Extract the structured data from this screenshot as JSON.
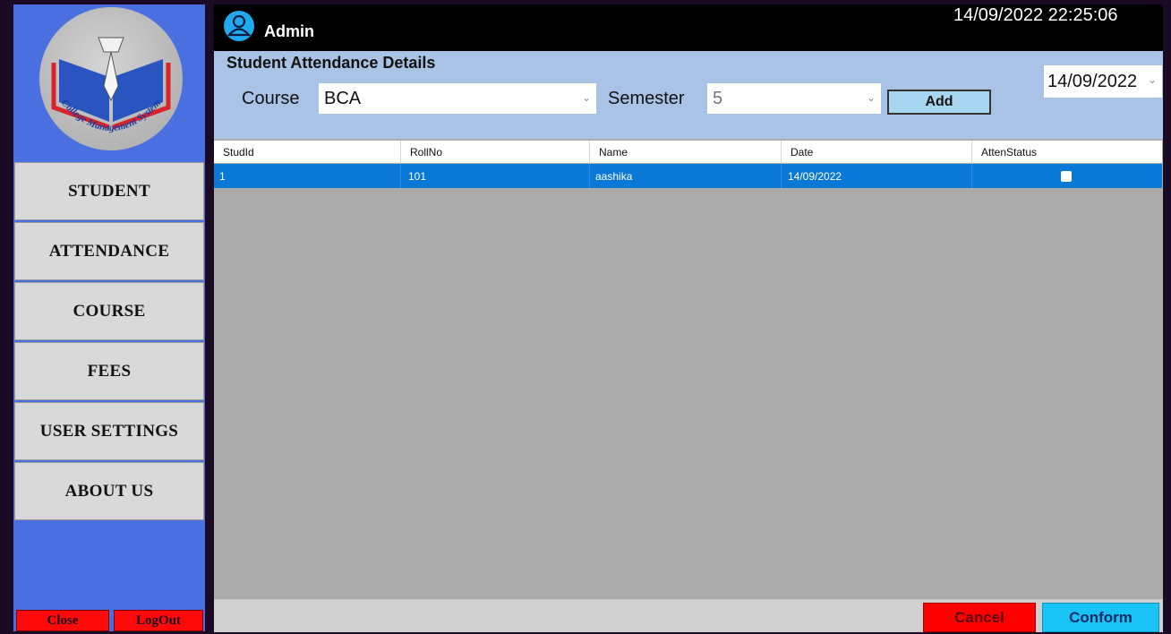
{
  "app": {
    "user": "Admin",
    "datetime": "14/09/2022 22:25:06",
    "logo_text": "College Management System"
  },
  "sidebar": {
    "items": [
      {
        "label": "STUDENT"
      },
      {
        "label": "ATTENDANCE"
      },
      {
        "label": "COURSE"
      },
      {
        "label": "FEES"
      },
      {
        "label": "USER SETTINGS"
      },
      {
        "label": "ABOUT US"
      }
    ],
    "close_label": "Close",
    "logout_label": "LogOut"
  },
  "panel": {
    "title": "Student Attendance Details",
    "course_label": "Course",
    "course_value": "BCA",
    "semester_label": "Semester",
    "semester_value": "5",
    "date_value": "14/09/2022",
    "add_label": "Add"
  },
  "grid": {
    "columns": [
      "StudId",
      "RollNo",
      "Name",
      "Date",
      "AttenStatus"
    ],
    "rows": [
      {
        "studid": "1",
        "rollno": "101",
        "name": "aashika",
        "date": "14/09/2022",
        "attenstatus": false
      }
    ]
  },
  "footer": {
    "cancel_label": "Cancel",
    "conform_label": "Conform"
  },
  "colors": {
    "sidebar": "#4a6fe0",
    "panel": "#a8c3e6",
    "selected_row": "#0a78d6",
    "cancel": "#ff0000",
    "conform": "#19c3f5"
  }
}
